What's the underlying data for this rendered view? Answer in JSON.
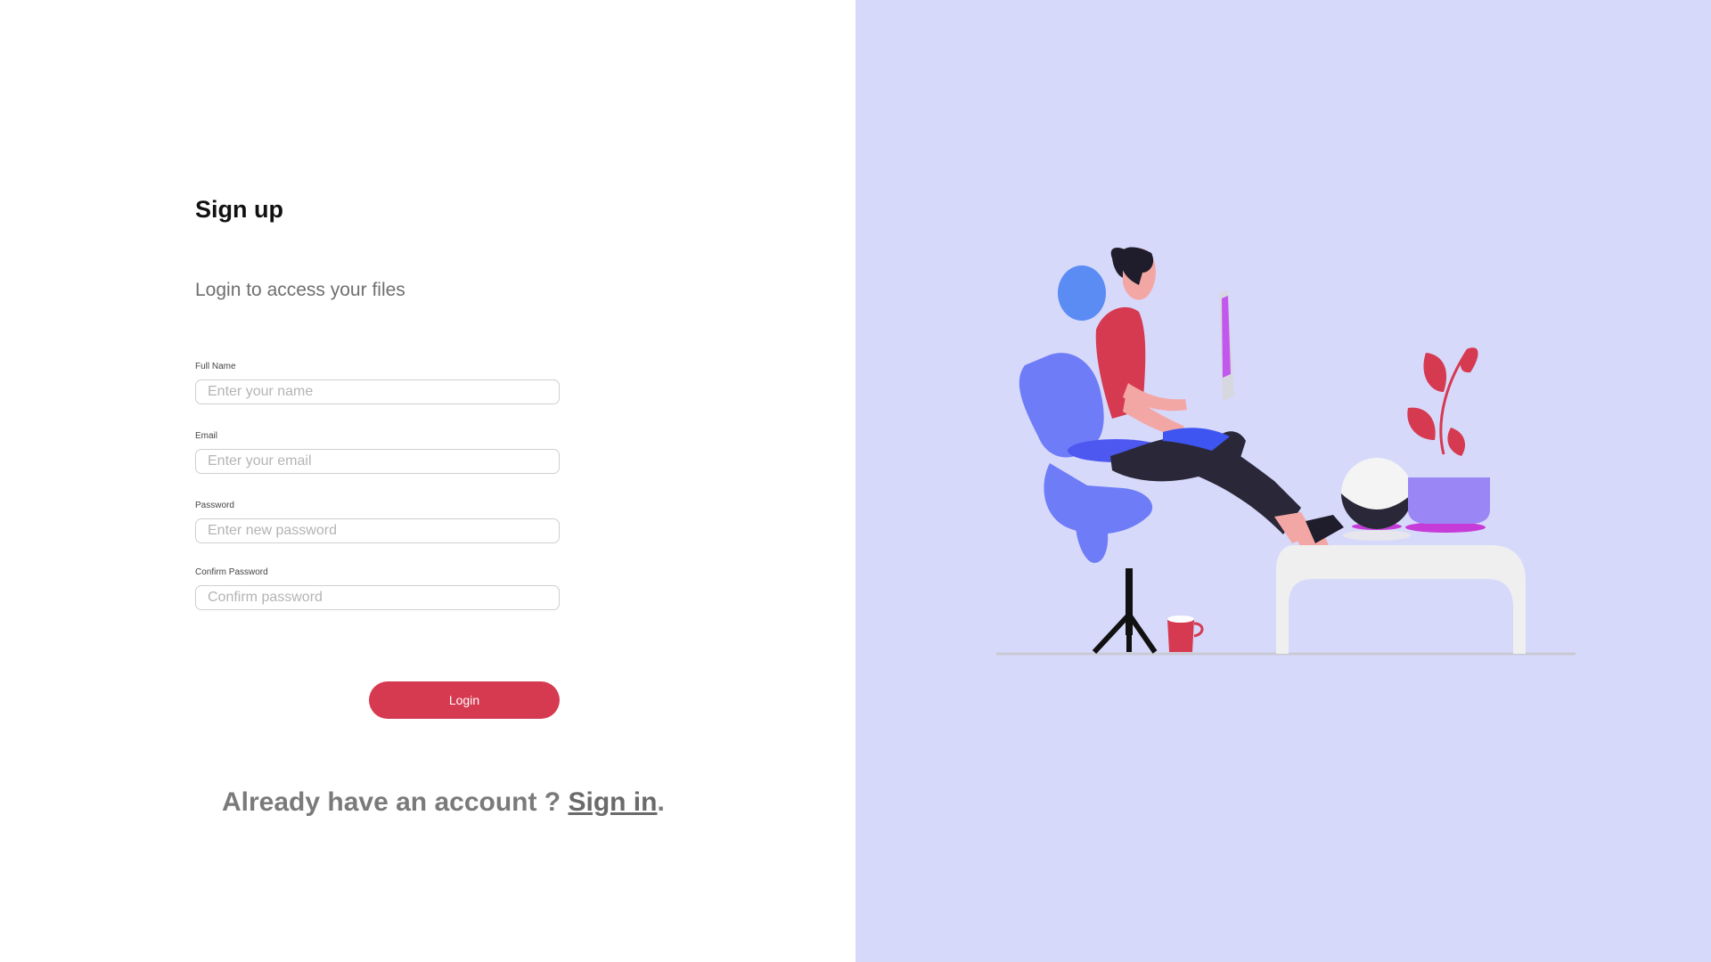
{
  "form": {
    "title": "Sign up",
    "subtitle": "Login to access your files",
    "fields": [
      {
        "label": "Full Name",
        "placeholder": "Enter your name"
      },
      {
        "label": "Email",
        "placeholder": "Enter your email"
      },
      {
        "label": "Password",
        "placeholder": "Enter new password"
      },
      {
        "label": "Confirm Password",
        "placeholder": "Confirm password"
      }
    ],
    "submit_label": "Login"
  },
  "footer": {
    "prompt": "Already have an account ? ",
    "link_label": "Sign in",
    "suffix": "."
  },
  "colors": {
    "accent": "#d63a51",
    "illustration_bg": "#d7d9fb"
  },
  "illustration": {
    "subject": "person-at-desk-illustration"
  }
}
